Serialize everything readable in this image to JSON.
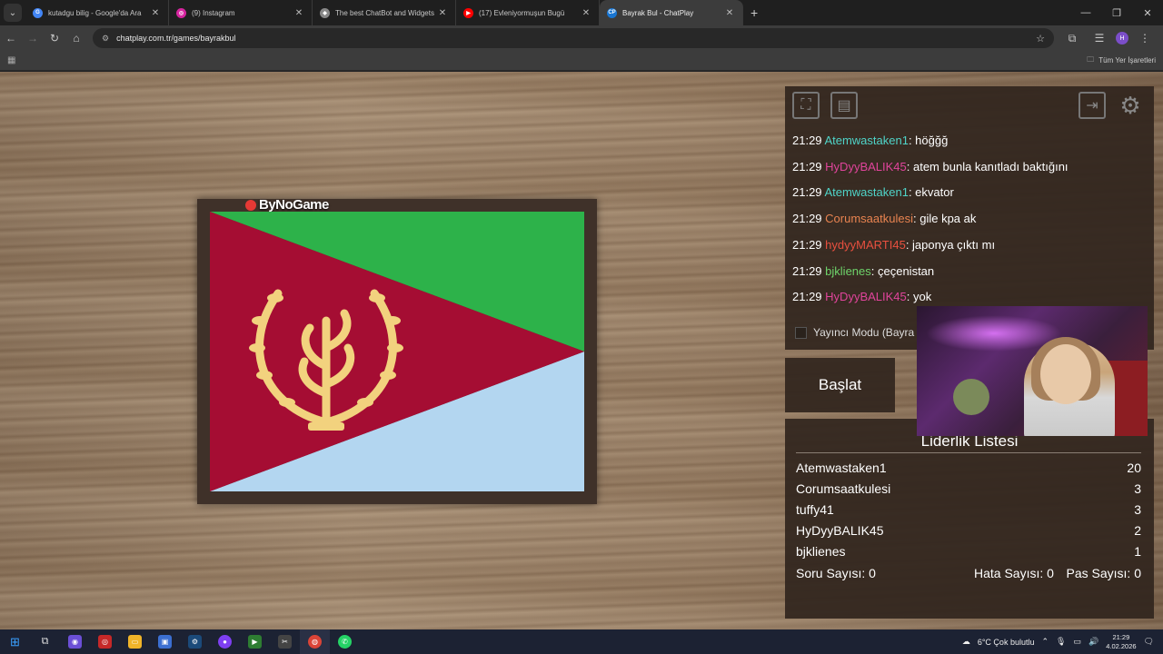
{
  "browser": {
    "tabs": [
      {
        "title": "kutadgu bilig - Google'da Ara",
        "favicon_color": "#4285f4",
        "favicon_glyph": "G"
      },
      {
        "title": "(9) Instagram",
        "favicon_color": "#d6249f",
        "favicon_glyph": "◎"
      },
      {
        "title": "The best ChatBot and Widgets",
        "favicon_color": "#888888",
        "favicon_glyph": "◆"
      },
      {
        "title": "(17) Evleniyormuşun Bugü",
        "favicon_color": "#ff0000",
        "favicon_glyph": "▶"
      },
      {
        "title": "Bayrak Bul - ChatPlay",
        "favicon_color": "#1976d2",
        "favicon_glyph": "CP"
      }
    ],
    "active_tab_index": 4,
    "url": "chatplay.com.tr/games/bayrakbul",
    "bookmarks_all_label": "Tüm Yer İşaretleri",
    "profile_initial": "H"
  },
  "game": {
    "logo_text": "ByNoGame",
    "flag_name": "eritrea-flag",
    "flag_colors": {
      "green": "#2db24a",
      "blue": "#b3d6f0",
      "red": "#a50d33",
      "emblem": "#f2d27e"
    }
  },
  "chat": {
    "messages": [
      {
        "time": "21:29",
        "user": "Atemwastaken1",
        "user_color": "#4fd4c8",
        "text": ": höğğğ"
      },
      {
        "time": "21:29",
        "user": "HyDyyBALIK45",
        "user_color": "#e0449b",
        "text": ": atem bunla kanıtladı baktığını"
      },
      {
        "time": "21:29",
        "user": "Atemwastaken1",
        "user_color": "#4fd4c8",
        "text": ": ekvator"
      },
      {
        "time": "21:29",
        "user": "Corumsaatkulesi",
        "user_color": "#e88350",
        "text": ": gile kpa ak"
      },
      {
        "time": "21:29",
        "user": "hydyyMARTI45",
        "user_color": "#e8503f",
        "text": ": japonya çıktı mı"
      },
      {
        "time": "21:29",
        "user": "bjklienes",
        "user_color": "#6ed36a",
        "text": ": çeçenistan"
      },
      {
        "time": "21:29",
        "user": "HyDyyBALIK45",
        "user_color": "#e0449b",
        "text": ": yok"
      }
    ],
    "streamer_mode_label": "Yayıncı Modu (Bayra"
  },
  "controls": {
    "start_label": "Başlat"
  },
  "leaderboard": {
    "title": "Liderlik Listesi",
    "rows": [
      {
        "name": "Atemwastaken1",
        "score": "20"
      },
      {
        "name": "Corumsaatkulesi",
        "score": "3"
      },
      {
        "name": "tuffy41",
        "score": "3"
      },
      {
        "name": "HyDyyBALIK45",
        "score": "2"
      },
      {
        "name": "bjklienes",
        "score": "1"
      }
    ],
    "questions_label": "Soru Sayısı: 0",
    "errors_label": "Hata Sayısı: 0",
    "passes_label": "Pas Sayısı: 0"
  },
  "taskbar": {
    "weather": "6°C  Çok bulutlu",
    "time": "21:29",
    "date": "4.02.2026"
  }
}
